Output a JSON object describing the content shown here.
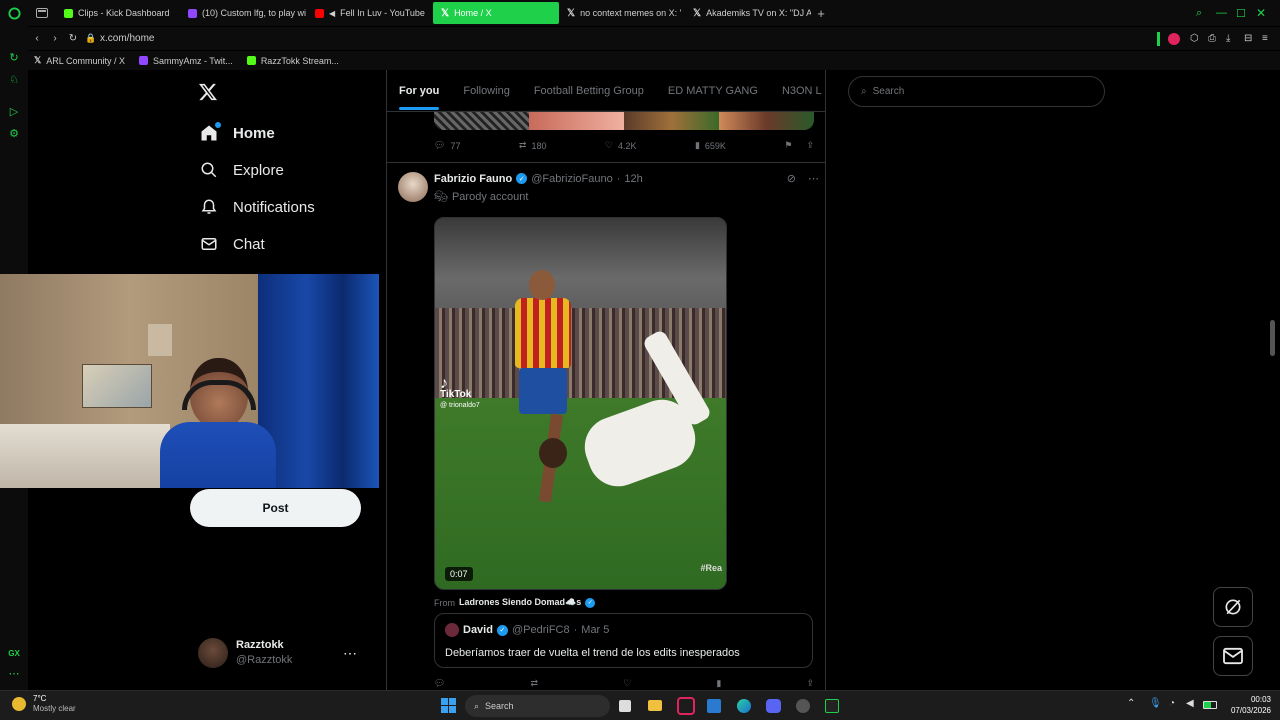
{
  "browser": {
    "tabs": [
      {
        "label": "Clips - Kick Dashboard",
        "color": "#53fc18"
      },
      {
        "label": "(10) Custom lfg, to play wi",
        "color": "#9146ff"
      },
      {
        "label": "Fell In Luv - YouTube",
        "color": "#ff0000"
      },
      {
        "label": "Home / X",
        "color": "#ffffff"
      },
      {
        "label": "no context memes on X: '",
        "color": "#ffffff"
      },
      {
        "label": "Akademiks TV on X: \"DJ A",
        "color": "#ffffff"
      }
    ],
    "active_tab": "Home / X",
    "url": "x.com/home",
    "bookmarks": [
      {
        "label": "ARL Community / X"
      },
      {
        "label": "SammyAmz - Twit..."
      },
      {
        "label": "RazzTokk Stream..."
      }
    ]
  },
  "nav": {
    "items": [
      {
        "label": "Home",
        "icon": "home-icon"
      },
      {
        "label": "Explore",
        "icon": "search-icon"
      },
      {
        "label": "Notifications",
        "icon": "bell-icon"
      },
      {
        "label": "Chat",
        "icon": "mail-icon"
      }
    ],
    "post_label": "Post",
    "account": {
      "name": "Razztokk",
      "handle": "@Razztokk"
    }
  },
  "feed": {
    "tabs": [
      "For you",
      "Following",
      "Football Betting Group",
      "ED MATTY GANG",
      "N3ON L"
    ],
    "prev_post_stats": {
      "replies": "77",
      "reposts": "180",
      "likes": "4.2K",
      "views": "659K"
    },
    "post": {
      "author": "Fabrizio Fauno",
      "handle": "@FabrizioFauno",
      "time": "12h",
      "tag": "Parody account",
      "video_duration": "0:07",
      "tiktok_label": "TikTok",
      "tiktok_handle": "@ trionaldo7",
      "watermark": "#Rea",
      "from_prefix": "From",
      "from_name": "Ladrones Siendo Domad☁️s",
      "quote": {
        "author": "David",
        "handle": "@PedriFC8",
        "time": "Mar 5",
        "text": "Deberíamos traer de vuelta el trend de los edits inesperados"
      }
    }
  },
  "sidebar": {
    "search_placeholder": "Search"
  },
  "taskbar": {
    "weather_temp": "7°C",
    "weather_desc": "Mostly clear",
    "search_label": "Search",
    "time": "00:03",
    "date": "07/03/2026"
  }
}
